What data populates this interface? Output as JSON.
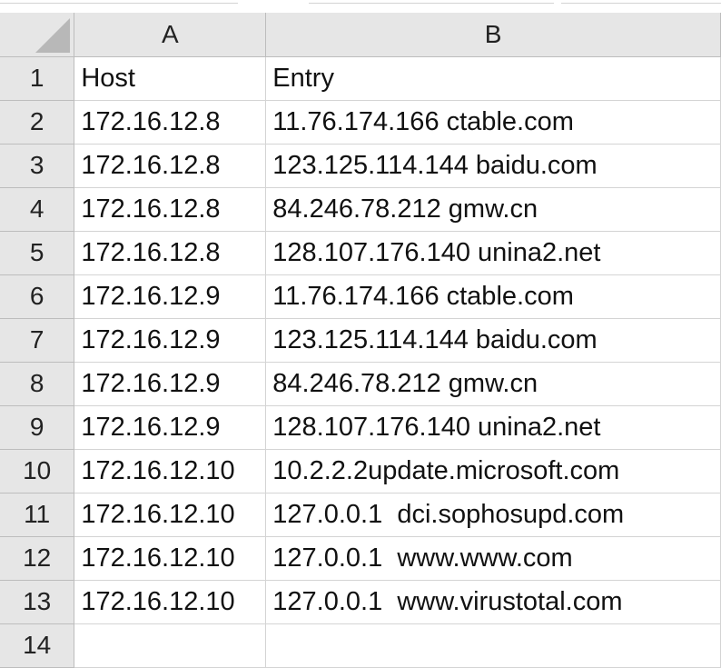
{
  "sheet": {
    "columns": [
      "A",
      "B"
    ],
    "rows": [
      {
        "num": "1",
        "a": "Host",
        "b": "Entry"
      },
      {
        "num": "2",
        "a": "172.16.12.8",
        "b": "11.76.174.166 ctable.com"
      },
      {
        "num": "3",
        "a": "172.16.12.8",
        "b": "123.125.114.144 baidu.com"
      },
      {
        "num": "4",
        "a": "172.16.12.8",
        "b": "84.246.78.212 gmw.cn"
      },
      {
        "num": "5",
        "a": "172.16.12.8",
        "b": "128.107.176.140 unina2.net"
      },
      {
        "num": "6",
        "a": "172.16.12.9",
        "b": "11.76.174.166 ctable.com"
      },
      {
        "num": "7",
        "a": "172.16.12.9",
        "b": "123.125.114.144 baidu.com"
      },
      {
        "num": "8",
        "a": "172.16.12.9",
        "b": "84.246.78.212 gmw.cn"
      },
      {
        "num": "9",
        "a": "172.16.12.9",
        "b": "128.107.176.140 unina2.net"
      },
      {
        "num": "10",
        "a": "172.16.12.10",
        "b": "10.2.2.2update.microsoft.com"
      },
      {
        "num": "11",
        "a": "172.16.12.10",
        "b": "127.0.0.1  dci.sophosupd.com"
      },
      {
        "num": "12",
        "a": "172.16.12.10",
        "b": "127.0.0.1  www.www.com"
      },
      {
        "num": "13",
        "a": "172.16.12.10",
        "b": "127.0.0.1  www.virustotal.com"
      },
      {
        "num": "14",
        "a": "",
        "b": ""
      }
    ]
  }
}
